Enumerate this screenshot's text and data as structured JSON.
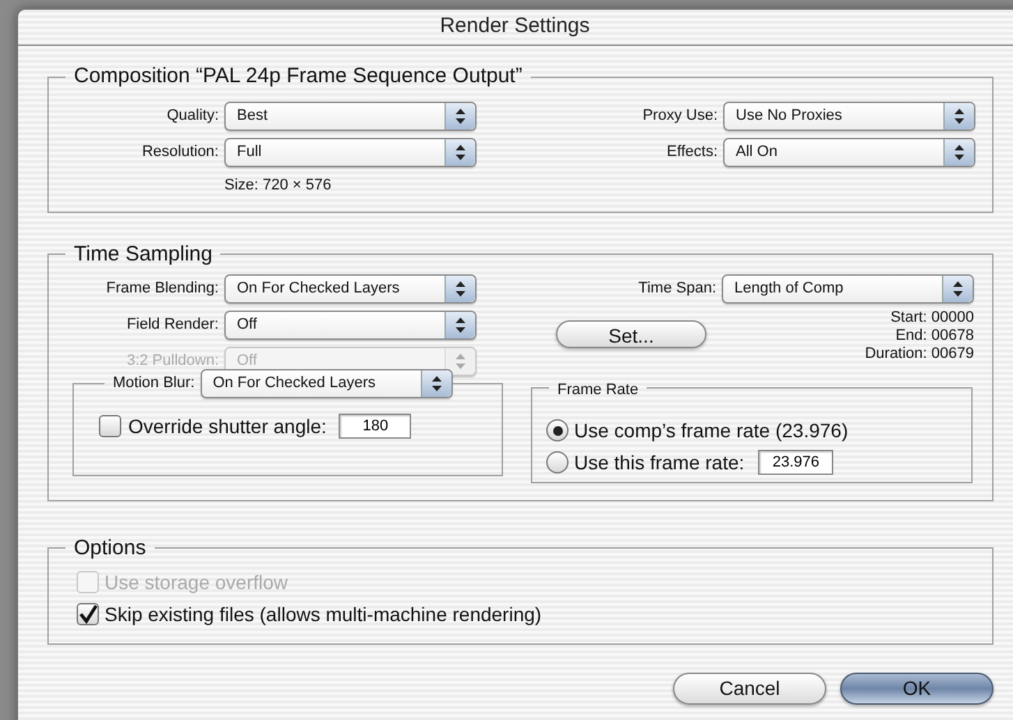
{
  "window": {
    "title": "Render Settings"
  },
  "composition": {
    "title": "Composition “PAL 24p Frame Sequence Output”",
    "left_fields": [
      {
        "label": "Quality:",
        "value": "Best"
      },
      {
        "label": "Resolution:",
        "value": "Full"
      }
    ],
    "size": "Size: 720 × 576",
    "right_fields": [
      {
        "label": "Proxy Use:",
        "value": "Use No Proxies"
      },
      {
        "label": "Effects:",
        "value": "All On"
      }
    ]
  },
  "time_sampling": {
    "title": "Time Sampling",
    "fields": [
      {
        "label": "Frame Blending:",
        "value": "On For Checked Layers",
        "disabled": false
      },
      {
        "label": "Field Render:",
        "value": "Off",
        "disabled": false
      },
      {
        "label": "3:2 Pulldown:",
        "value": "Off",
        "disabled": true
      }
    ],
    "motion_blur": {
      "label": "Motion Blur:",
      "value": "On For Checked Layers",
      "override": {
        "label": "Override shutter angle:",
        "checked": false,
        "value": "180"
      }
    },
    "time_span": {
      "label": "Time Span:",
      "value": "Length of Comp"
    },
    "set_button": "Set...",
    "span_info": [
      "Start: 00000",
      "End: 00678",
      "Duration: 00679"
    ],
    "frame_rate": {
      "title": "Frame Rate",
      "options": [
        {
          "label": "Use comp’s frame rate (23.976)",
          "selected": true
        },
        {
          "label": "Use this frame rate:",
          "selected": false,
          "value": "23.976"
        }
      ]
    }
  },
  "options": {
    "title": "Options",
    "checkboxes": [
      {
        "label": "Use storage overflow",
        "checked": false,
        "disabled": true
      },
      {
        "label": "Skip existing files (allows multi-machine rendering)",
        "checked": true,
        "disabled": false
      }
    ]
  },
  "buttons": [
    {
      "label": "Cancel",
      "default": false
    },
    {
      "label": "OK",
      "default": true
    }
  ]
}
